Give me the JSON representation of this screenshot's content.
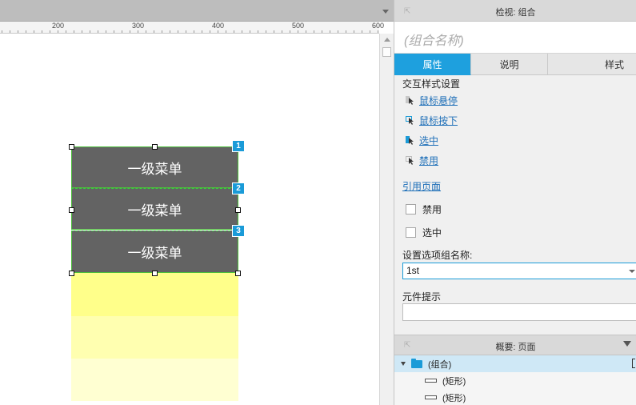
{
  "ruler": {
    "labels": [
      "200",
      "300",
      "400",
      "500",
      "600"
    ]
  },
  "canvas": {
    "menu_items": [
      {
        "label": "一级菜单",
        "badge": "1"
      },
      {
        "label": "一级菜单",
        "badge": "2"
      },
      {
        "label": "一级菜单",
        "badge": "3"
      }
    ],
    "yellow_colors": [
      "#ffff8a",
      "#ffffb0",
      "#ffffd2"
    ]
  },
  "inspector": {
    "title": "检视: 组合",
    "name_placeholder": "(组合名称)",
    "tabs": [
      "属性",
      "说明",
      "样式"
    ],
    "interaction_section": "交互样式设置",
    "interactions": [
      "鼠标悬停",
      "鼠标按下",
      "选中",
      "禁用"
    ],
    "reference_page": "引用页面",
    "checkboxes": [
      "禁用",
      "选中"
    ],
    "group_name_label": "设置选项组名称:",
    "group_name_value": "1st",
    "tooltip_label": "元件提示"
  },
  "outline": {
    "title": "概要: 页面",
    "group_label": "(组合)",
    "shape_labels": [
      "(矩形)",
      "(矩形)"
    ]
  },
  "colors": {
    "accent": "#1ea0de",
    "menu_bg": "#636363",
    "selection": "#4cbf3a"
  }
}
